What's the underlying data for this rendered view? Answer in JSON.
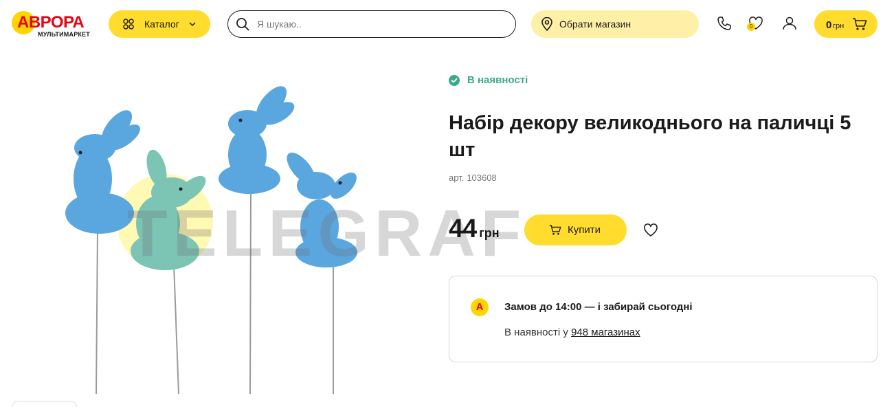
{
  "header": {
    "logo_text": "АВРОРА",
    "logo_subtext": "МУЛЬТИМАРКЕТ",
    "catalog_label": "Каталог",
    "search_placeholder": "Я шукаю..",
    "store_label": "Обрати магазин",
    "wishlist_count": "0",
    "cart_amount": "0",
    "cart_currency": "грн"
  },
  "gallery": {
    "watermark_text": "TELEGRAF"
  },
  "product": {
    "stock_status": "В наявності",
    "title": "Набір декору великоднього на паличці 5 шт",
    "article_label": "арт.",
    "article_number": "103608",
    "price_value": "44",
    "price_currency": "грн",
    "buy_label": "Купити"
  },
  "pickup": {
    "logo_letter": "А",
    "headline": "Замов до 14:00 — і забирай сьогодні",
    "availability_prefix": "В наявності у",
    "availability_link": "948 магазинах"
  },
  "colors": {
    "accent_yellow": "#ffdc2e",
    "store_pill": "#fff0a8",
    "brand_red": "#e30613",
    "stock_green": "#3aa98c",
    "bunny_blue": "#5aa6df"
  },
  "icons": {
    "catalog": "grid-dots-icon",
    "search": "search-icon",
    "store": "map-pin-icon",
    "phone": "phone-icon",
    "wishlist": "heart-icon",
    "account": "user-icon",
    "cart": "cart-icon",
    "stock": "check-circle-icon"
  }
}
